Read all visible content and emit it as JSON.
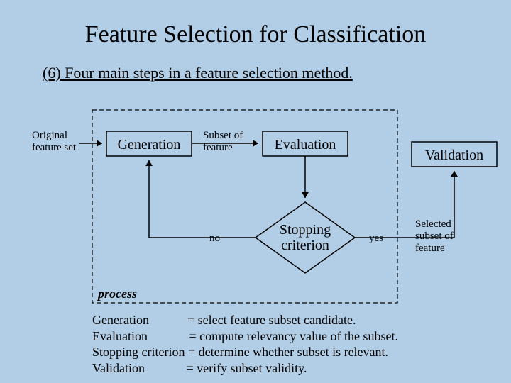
{
  "title": "Feature Selection for Classification",
  "subtitle": "(6) Four main steps in a feature selection method.",
  "labels": {
    "original1": "Original",
    "original2": "feature set",
    "generation": "Generation",
    "subset1": "Subset of",
    "subset2": "feature",
    "evaluation": "Evaluation",
    "validation": "Validation",
    "no": "no",
    "yes": "yes",
    "stopping1": "Stopping",
    "stopping2": "criterion",
    "selected1": "Selected",
    "selected2": "subset of",
    "selected3": "feature",
    "process": "process"
  },
  "defs": {
    "l1": "Generation            = select feature subset candidate.",
    "l2": "Evaluation             = compute relevancy value of the subset.",
    "l3": "Stopping criterion = determine whether subset is relevant.",
    "l4": "Validation             = verify subset validity."
  }
}
